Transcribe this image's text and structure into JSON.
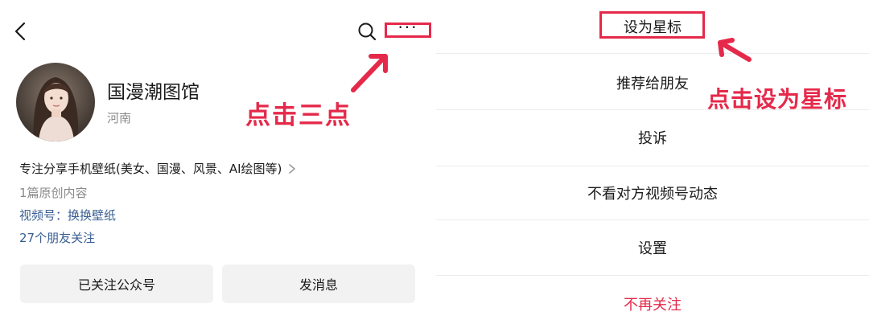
{
  "left": {
    "account": {
      "name": "国漫潮图馆",
      "region": "河南",
      "description": "专注分享手机壁纸(美女、国漫、风景、AI绘图等)",
      "original_count": "1篇原创内容",
      "channel": "视频号：换换壁纸",
      "followers": "27个朋友关注"
    },
    "buttons": {
      "followed": "已关注公众号",
      "message": "发消息"
    },
    "annotation": "点击三点",
    "more_dots": "···"
  },
  "right": {
    "menu": [
      "设为星标",
      "推荐给朋友",
      "投诉",
      "不看对方视频号动态",
      "设置",
      "不再关注"
    ],
    "annotation": "点击设为星标"
  },
  "colors": {
    "accent_red": "#e5294a",
    "link_blue": "#3a5f92",
    "muted_gray": "#8a8a8a",
    "button_bg": "#f2f2f2"
  },
  "icons": {
    "back": "chevron-left-icon",
    "search": "search-icon",
    "more": "more-dots-icon",
    "chevron": "chevron-right-icon"
  }
}
